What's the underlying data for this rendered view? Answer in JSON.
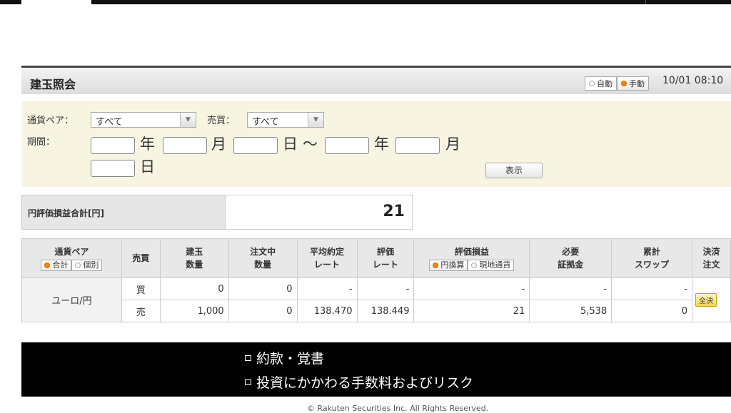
{
  "header": {
    "title": "建玉照会",
    "mode_auto": "自動",
    "mode_manual": "手動",
    "clock": "10/01 08:10"
  },
  "filter": {
    "pair_label": "通貨ペア：",
    "pair_value": "すべて",
    "side_label": "売買：",
    "side_value": "すべて",
    "period_label": "期間：",
    "year": "年",
    "month": "月",
    "day": "日",
    "tilde": "〜",
    "show_button": "表示"
  },
  "summary": {
    "label": "円評価損益合計[円]",
    "value": "21"
  },
  "table": {
    "headers": {
      "pair": "通貨ペア",
      "total": "合計",
      "individual": "個別",
      "side": "売買",
      "pos_qty": "建玉\n数量",
      "order_qty": "注文中\n数量",
      "avg_rate": "平均約定\nレート",
      "eval_rate": "評価\nレート",
      "pnl": "評価損益",
      "yen_conv": "円換算",
      "local_ccy": "現地通貨",
      "margin": "必要\n証拠金",
      "swap": "累計\nスワップ",
      "settle": "決済\n注文"
    },
    "pair_name": "ユーロ/円",
    "rows": [
      {
        "side": "買",
        "pos_qty": "0",
        "order_qty": "0",
        "avg_rate": "-",
        "eval_rate": "-",
        "pnl": "-",
        "margin": "-",
        "swap": "-"
      },
      {
        "side": "売",
        "pos_qty": "1,000",
        "order_qty": "0",
        "avg_rate": "138.470",
        "eval_rate": "138.449",
        "pnl": "21",
        "margin": "5,538",
        "swap": "0"
      }
    ],
    "settle_all": "全決"
  },
  "footer": {
    "link1": "約款・覚書",
    "link2": "投資にかかわる手数料およびリスク",
    "copyright": "© Rakuten Securities Inc. All Rights Reserved."
  },
  "colors": {
    "accent_orange": "#f08a00",
    "buy": "#cc0000",
    "sell": "#1a4db3",
    "filter_bg": "#f7f4e2"
  }
}
